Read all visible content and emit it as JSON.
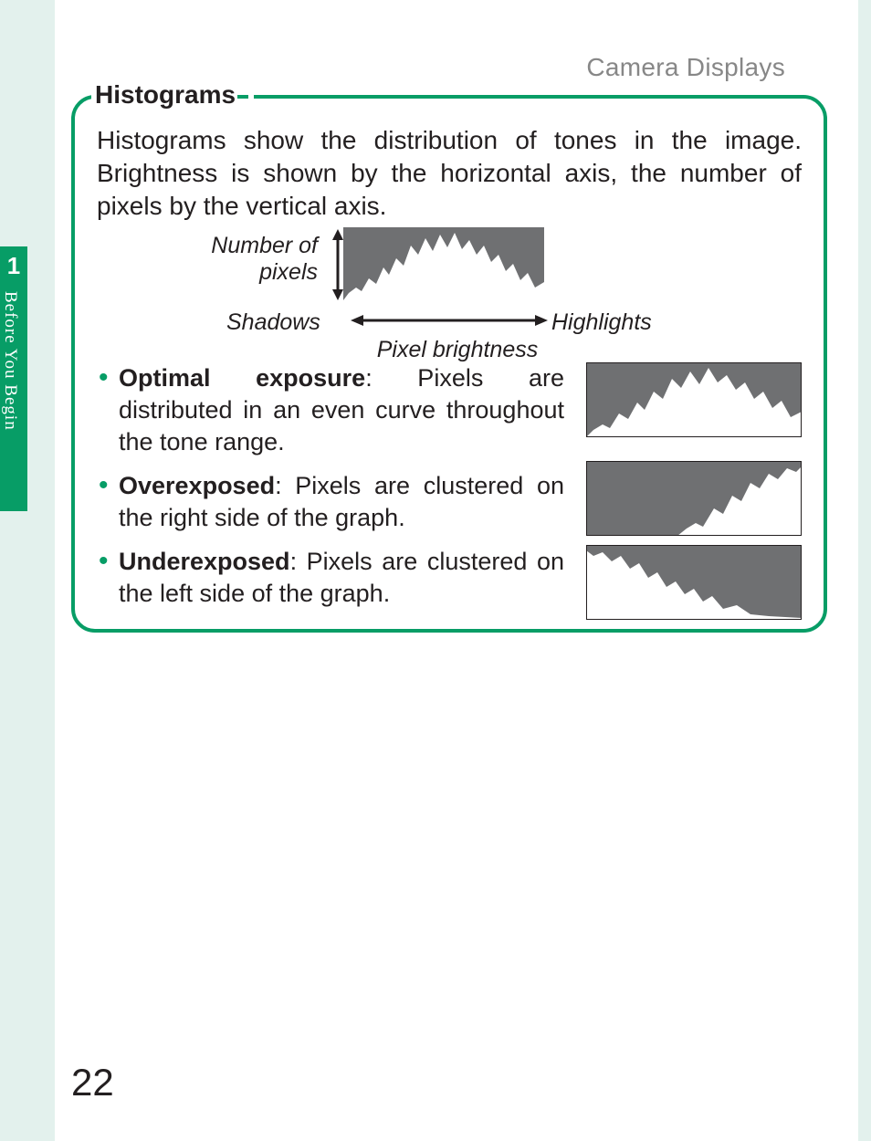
{
  "header": {
    "section": "Camera Displays"
  },
  "sidebar": {
    "chapter_number": "1",
    "chapter_title": "Before You Begin"
  },
  "box": {
    "title": "Histograms",
    "intro": "Histograms show the distribution of tones in the image. Brightness is shown by the horizontal axis, the number of pixels by the vertical axis.",
    "diagram": {
      "yaxis": "Number of pixels",
      "left": "Shadows",
      "right": "Highlights",
      "xaxis": "Pixel brightness"
    },
    "items": [
      {
        "term": "Optimal exposure",
        "desc": ": Pixels are distributed in an even curve throughout the tone range."
      },
      {
        "term": "Overexposed",
        "desc": ": Pixels are clustered on the right side of the graph."
      },
      {
        "term": "Underexposed",
        "desc": ": Pixels are clustered on the left side of the graph."
      }
    ]
  },
  "page_number": "22",
  "colors": {
    "accent": "#079d66",
    "graph_bg": "#6f7072"
  }
}
